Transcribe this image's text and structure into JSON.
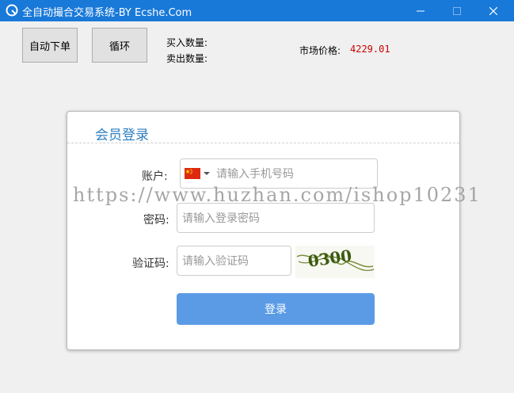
{
  "window": {
    "title": "全自动撮合交易系统-BY Ecshe.Com"
  },
  "toolbar": {
    "auto_order_label": "自动下单",
    "loop_label": "循环",
    "buy_qty_label": "买入数量:",
    "sell_qty_label": "卖出数量:",
    "market_price_label": "市场价格:",
    "market_price_value": "4229.01"
  },
  "login": {
    "title": "会员登录",
    "account_label": "账户:",
    "account_placeholder": "请输入手机号码",
    "password_label": "密码:",
    "password_placeholder": "请输入登录密码",
    "captcha_label": "验证码:",
    "captcha_placeholder": "请输入验证码",
    "captcha_text": "0300",
    "submit_label": "登录"
  },
  "watermark": "https://www.huzhan.com/ishop10231",
  "colors": {
    "titlebar": "#1979d9",
    "login_button": "#5b9be6",
    "price": "#cc0000",
    "panel_title": "#2f7fc0"
  }
}
